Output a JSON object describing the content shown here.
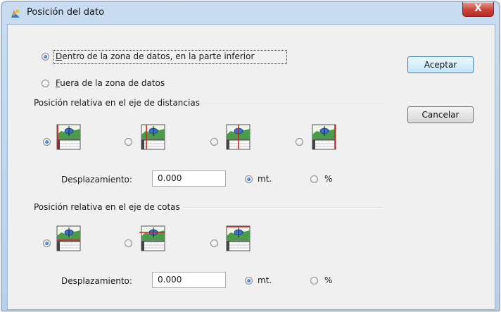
{
  "window": {
    "title": "Posición del dato",
    "close_label": "X"
  },
  "zone": {
    "inside_label": "Dentro de la zona de datos, en la parte inferior",
    "inside_selected": true,
    "outside_label": "Fuera de la zona de datos",
    "outside_selected": false
  },
  "distances": {
    "title": "Posición relativa en el eje de distancias",
    "options": [
      {
        "icon": "position-left-icon",
        "selected": true
      },
      {
        "icon": "position-left-inner-icon",
        "selected": false
      },
      {
        "icon": "position-center-icon",
        "selected": false
      },
      {
        "icon": "position-right-icon",
        "selected": false
      }
    ],
    "offset_label": "Desplazamiento:",
    "offset_value": "0.000",
    "unit_mt": "mt.",
    "unit_pct": "%",
    "unit_selected": "mt."
  },
  "heights": {
    "title": "Posición relativa en el eje de cotas",
    "options": [
      {
        "icon": "position-bottom-icon",
        "selected": true
      },
      {
        "icon": "position-middle-icon",
        "selected": false
      },
      {
        "icon": "position-top-icon",
        "selected": false
      }
    ],
    "offset_label": "Desplazamiento:",
    "offset_value": "0.000",
    "unit_mt": "mt.",
    "unit_pct": "%",
    "unit_selected": "mt."
  },
  "buttons": {
    "ok": "Aceptar",
    "cancel": "Cancelar"
  },
  "colors": {
    "accent": "#1f56a5",
    "marker_red": "#d42020",
    "terrain_green": "#4c9a4c"
  }
}
